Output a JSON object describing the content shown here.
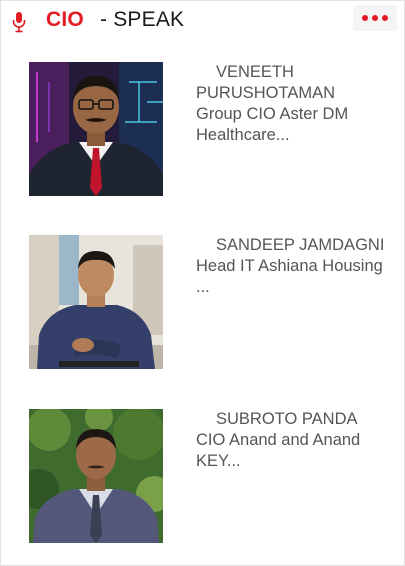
{
  "header": {
    "brand": "CIO",
    "suffix": "- SPEAK",
    "icons": {
      "mic": "microphone-icon",
      "menu": "more-dots-icon"
    }
  },
  "colors": {
    "accent": "#e31b23",
    "text": "#555555"
  },
  "speakers": [
    {
      "name": "VENEETH PURUSHOTAMAN",
      "role": "Group CIO Aster DM Healthcare..."
    },
    {
      "name": "SANDEEP JAMDAGNI",
      "role": "Head IT Ashiana Housing ..."
    },
    {
      "name": "SUBROTO PANDA",
      "role": "CIO Anand and Anand KEY..."
    }
  ]
}
